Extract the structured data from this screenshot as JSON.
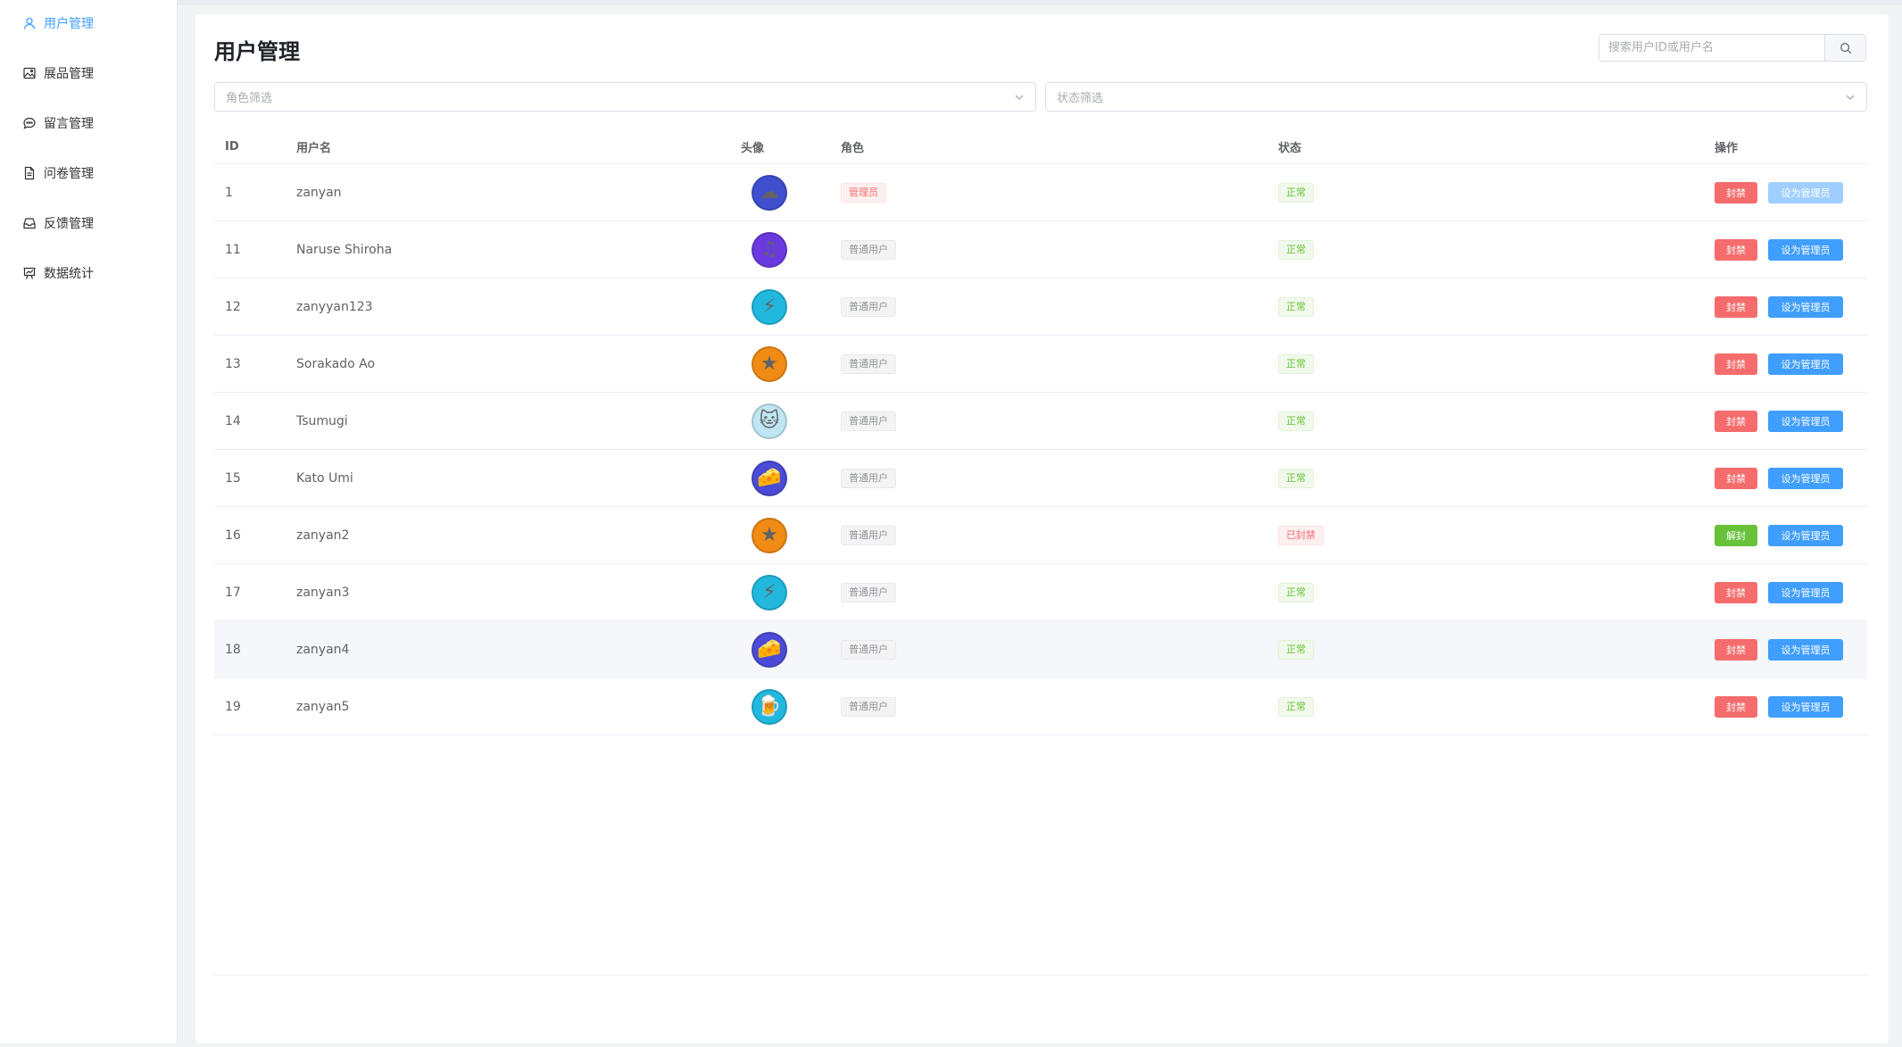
{
  "sidebar": {
    "items": [
      {
        "label": "用户管理",
        "icon": "user-icon",
        "active": true
      },
      {
        "label": "展品管理",
        "icon": "picture-icon",
        "active": false
      },
      {
        "label": "留言管理",
        "icon": "chat-icon",
        "active": false
      },
      {
        "label": "问卷管理",
        "icon": "document-icon",
        "active": false
      },
      {
        "label": "反馈管理",
        "icon": "inbox-icon",
        "active": false
      },
      {
        "label": "数据统计",
        "icon": "chart-icon",
        "active": false
      }
    ]
  },
  "header": {
    "title": "用户管理",
    "search_placeholder": "搜索用户ID或用户名"
  },
  "filters": {
    "role_placeholder": "角色筛选",
    "status_placeholder": "状态筛选"
  },
  "table": {
    "columns": [
      "ID",
      "用户名",
      "头像",
      "角色",
      "状态",
      "操作"
    ],
    "rows": [
      {
        "id": "1",
        "username": "zanyan",
        "avatar": "☁",
        "avatar_color": "#3f4fcf",
        "role": "管理员",
        "status": "正常",
        "ban_label": "封禁",
        "admin_label": "设为管理员"
      },
      {
        "id": "11",
        "username": "Naruse Shiroha",
        "avatar": "♫",
        "avatar_color": "#6a3ae0",
        "role": "普通用户",
        "status": "正常",
        "ban_label": "封禁",
        "admin_label": "设为管理员"
      },
      {
        "id": "12",
        "username": "zanyyan123",
        "avatar": "⚡",
        "avatar_color": "#22b8de",
        "role": "普通用户",
        "status": "正常",
        "ban_label": "封禁",
        "admin_label": "设为管理员"
      },
      {
        "id": "13",
        "username": "Sorakado Ao",
        "avatar": "★",
        "avatar_color": "#f08b14",
        "role": "普通用户",
        "status": "正常",
        "ban_label": "封禁",
        "admin_label": "设为管理员"
      },
      {
        "id": "14",
        "username": "Tsumugi",
        "avatar": "🐱",
        "avatar_color": "#bfe6f2",
        "role": "普通用户",
        "status": "正常",
        "ban_label": "封禁",
        "admin_label": "设为管理员"
      },
      {
        "id": "15",
        "username": "Kato Umi",
        "avatar": "🧀",
        "avatar_color": "#4a4bd6",
        "role": "普通用户",
        "status": "正常",
        "ban_label": "封禁",
        "admin_label": "设为管理员"
      },
      {
        "id": "16",
        "username": "zanyan2",
        "avatar": "★",
        "avatar_color": "#f08b14",
        "role": "普通用户",
        "status": "已封禁",
        "ban_label": "解封",
        "admin_label": "设为管理员"
      },
      {
        "id": "17",
        "username": "zanyan3",
        "avatar": "⚡",
        "avatar_color": "#22b8de",
        "role": "普通用户",
        "status": "正常",
        "ban_label": "封禁",
        "admin_label": "设为管理员"
      },
      {
        "id": "18",
        "username": "zanyan4",
        "avatar": "🧀",
        "avatar_color": "#4a4bd6",
        "role": "普通用户",
        "status": "正常",
        "ban_label": "封禁",
        "admin_label": "设为管理员"
      },
      {
        "id": "19",
        "username": "zanyan5",
        "avatar": "🍺",
        "avatar_color": "#22b8de",
        "role": "普通用户",
        "status": "正常",
        "ban_label": "封禁",
        "admin_label": "设为管理员"
      }
    ]
  }
}
